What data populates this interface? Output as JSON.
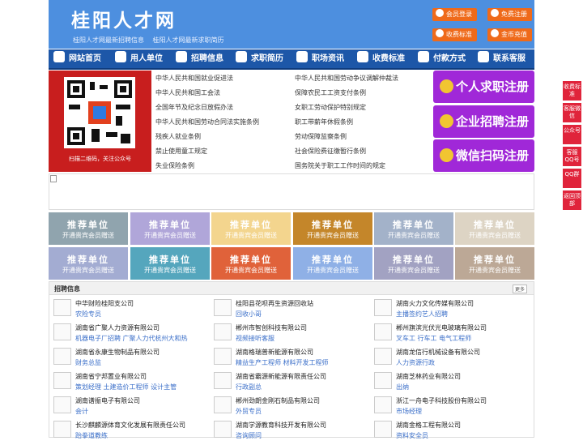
{
  "header": {
    "site_name": "桂阳人才网",
    "slogan_1": "桂阳人才网最新招聘信息",
    "slogan_2": "桂阳人才网最新求职简历",
    "btn_member_login": "会员登录",
    "btn_free_register": "免费注册",
    "btn_fee_standard": "收费标准",
    "btn_gold_recharge": "金币充值",
    "accent_color": "#ef6a1a",
    "header_color": "#4d8fdf"
  },
  "nav": {
    "color": "#1d57a8",
    "items": [
      {
        "label": "网站首页",
        "icon": "home-icon"
      },
      {
        "label": "用人单位",
        "icon": "building-icon"
      },
      {
        "label": "招聘信息",
        "icon": "people-icon"
      },
      {
        "label": "求职简历",
        "icon": "resume-icon"
      },
      {
        "label": "职场资讯",
        "icon": "news-icon"
      },
      {
        "label": "收费标准",
        "icon": "fee-icon"
      },
      {
        "label": "付款方式",
        "icon": "card-icon"
      },
      {
        "label": "联系客服",
        "icon": "phone-icon"
      }
    ]
  },
  "qr": {
    "caption": "扫描二维码，关注公众号"
  },
  "laws": {
    "left": [
      "中华人民共和国就业促进法",
      "中华人民共和国工会法",
      "全国年节及纪念日放假办法",
      "中华人民共和国劳动合同法实施条例",
      "残疾人就业条例",
      "禁止使用童工规定",
      "失业保险条例"
    ],
    "right": [
      "中华人民共和国劳动争议调解仲裁法",
      "保障农民工工资支付条例",
      "女职工劳动保护特别规定",
      "职工带薪年休假条例",
      "劳动保障监察条例",
      "社会保险费征缴暂行条例",
      "国务院关于职工工作时间的规定"
    ]
  },
  "actions": {
    "job_seeker": "个人求职注册",
    "employer": "企业招聘注册",
    "wechat": "微信扫码注册",
    "color": "#a028d8"
  },
  "recommend": {
    "title": "推荐单位",
    "subtitle": "开通贵宾会员赠送",
    "colors": [
      "#90a4ae",
      "#b0a6d9",
      "#f3d58e",
      "#c4862a",
      "#a3b2c9",
      "#ddd4c4",
      "#a3acd2",
      "#55a6bd",
      "#e0623a",
      "#8fb0e6",
      "#a2a2c2",
      "#bca896"
    ]
  },
  "jobs": {
    "title": "招聘信息",
    "more": "更多",
    "items": [
      {
        "company": "中华财险桂阳支公司",
        "position": "农险专员"
      },
      {
        "company": "桂阳县花呗再生资源回收站",
        "position": "回收小哥"
      },
      {
        "company": "湖南火力文化传媒有限公司",
        "position": "主播签约艺人招聘"
      },
      {
        "company": "湖南省广聚人力资源有限公司",
        "position": "机器电子厂招聘 广聚人力代杭州大和热"
      },
      {
        "company": "郴州市智创科技有限公司",
        "position": "视频接听客服"
      },
      {
        "company": "郴州旗滨光伏光电玻璃有限公司",
        "position": "叉车工 行车工 电气工程师"
      },
      {
        "company": "湖南省永康生物制品有限公司",
        "position": "财务总监"
      },
      {
        "company": "湖南格瑞普新能源有限公司",
        "position": "精益生产工程师 材料开发工程师"
      },
      {
        "company": "湖南龙信行机械设备有限公司",
        "position": "人力资源行政"
      },
      {
        "company": "湖南省宁邦置业有限公司",
        "position": "策划经理 土建造价工程师 设计主管"
      },
      {
        "company": "湖南省霸源新能源有限责任公司",
        "position": "行政副总"
      },
      {
        "company": "湖南芝林药业有限公司",
        "position": "出纳"
      },
      {
        "company": "湖南谱振电子有限公司",
        "position": "会计"
      },
      {
        "company": "郴州劲朗金刚石制品有限公司",
        "position": "外贸专员"
      },
      {
        "company": "浙江一舟电子科技股份有限公司",
        "position": "市场经理"
      },
      {
        "company": "长沙麒麟源体育文化发展有限责任公司",
        "position": "跆拳道教练"
      },
      {
        "company": "湖南学源教育科技开发有限公司",
        "position": "咨询顾问"
      },
      {
        "company": "湖南金格工程有限公司",
        "position": "资料安全员"
      }
    ]
  },
  "side": {
    "color": "#e0243b",
    "items": [
      "收费标准",
      "客服微信",
      "公众号",
      "客服QQ号",
      "QQ群",
      "返回顶部"
    ]
  }
}
